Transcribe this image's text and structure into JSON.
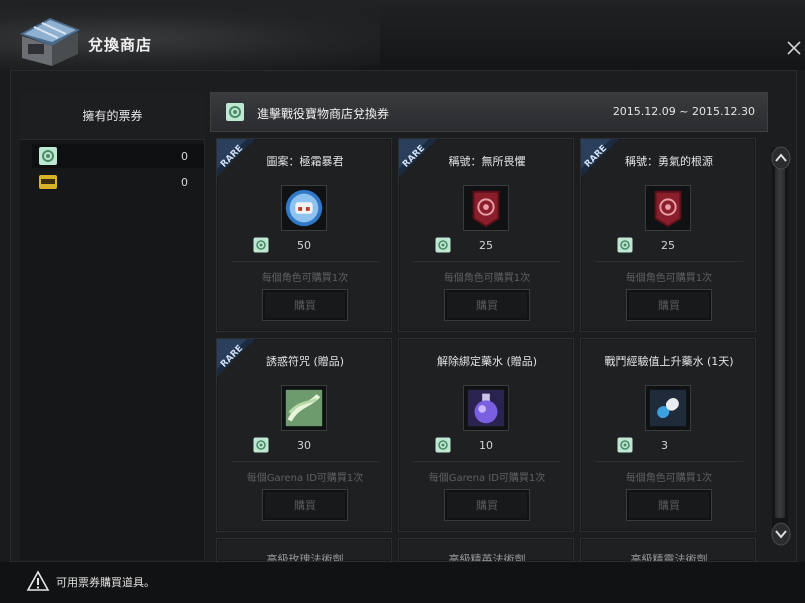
{
  "window": {
    "title": "兌換商店",
    "logo_icon": "shop-stall-icon",
    "close_icon": "close-icon"
  },
  "left_panel": {
    "header": "擁有的票券",
    "tickets": [
      {
        "icon": "garena-ticket-icon",
        "count": "0"
      },
      {
        "icon": "yellow-ticket-icon",
        "count": "0"
      }
    ]
  },
  "shop": {
    "title": "進擊戰役寶物商店兌換券",
    "dates": "2015.12.09 ~ 2015.12.30",
    "rare_label": "RARE",
    "buy_label": "購買",
    "items": [
      {
        "name": "圖案：極霜暴君",
        "price": "50",
        "limit": "每個角色可購買1次",
        "rare": true,
        "icon": "frost-tyrant-emblem-icon"
      },
      {
        "name": "稱號：無所畏懼",
        "price": "25",
        "limit": "每個角色可購買1次",
        "rare": true,
        "icon": "title-banner-icon"
      },
      {
        "name": "稱號：勇氣的根源",
        "price": "25",
        "limit": "每個角色可購買1次",
        "rare": true,
        "icon": "title-banner-icon"
      },
      {
        "name": "誘惑符咒 (贈品)",
        "price": "30",
        "limit": "每個Garena ID可購買1次",
        "rare": true,
        "icon": "charm-icon"
      },
      {
        "name": "解除綁定藥水 (贈品)",
        "price": "10",
        "limit": "每個Garena ID可購買1次",
        "rare": false,
        "icon": "unbind-potion-icon"
      },
      {
        "name": "戰鬥經驗值上升藥水 (1天)",
        "price": "3",
        "limit": "每個角色可購買1次",
        "rare": false,
        "icon": "exp-capsule-icon"
      }
    ],
    "partial_items": [
      {
        "name": "高級玫瑰法術劑"
      },
      {
        "name": "高級精英法術劑"
      },
      {
        "name": "高級精靈法術劑"
      }
    ]
  },
  "footer": {
    "text": "可用票券購買道具。",
    "icon": "warning-icon"
  },
  "colors": {
    "background": "#1a1b1d",
    "card": "#1f2022",
    "rare_ribbon": "#2a3f5c",
    "banner_red": "#8a1f2b",
    "ticket_green": "#7fc9a0"
  }
}
